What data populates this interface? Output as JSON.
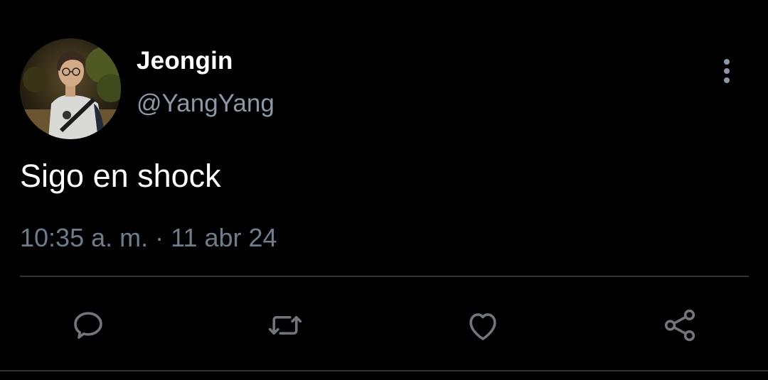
{
  "user": {
    "display_name": "Jeongin",
    "handle": "@YangYang",
    "avatar_icon": "profile-photo"
  },
  "tweet": {
    "text": "Sigo en shock",
    "time": "10:35 a. m.",
    "separator": "·",
    "date": "11 abr 24"
  },
  "actions": {
    "reply_icon": "speech-bubble-icon",
    "retweet_icon": "retweet-arrows-icon",
    "like_icon": "heart-icon",
    "share_icon": "share-nodes-icon",
    "more_icon": "vertical-ellipsis-icon"
  },
  "colors": {
    "background": "#000000",
    "primary_text": "#ffffff",
    "secondary_text": "#8b98a5",
    "icon": "#71767b",
    "divider": "#2f3336"
  }
}
